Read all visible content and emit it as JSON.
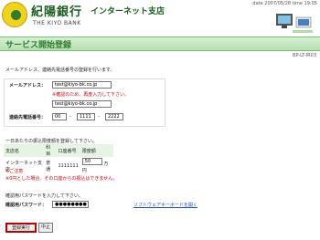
{
  "header": {
    "bank_name": "紀陽銀行",
    "branch_name": "インターネット支店",
    "bank_name_en": "THE KIYO BANK",
    "date_text": "date 2007/05/28 time 19:05"
  },
  "page": {
    "title": "サービス開始登録",
    "screen_code": "BP-LT-IR03",
    "instruction": "メールアドレス、連絡先電話番号の登録を行います。"
  },
  "contact_form": {
    "email_label": "メールアドレス：",
    "email_value": "test@kiyo-bk.co.jp",
    "email_note": "※確認のため、再度入力して下さい。",
    "email_confirm_value": "test@kiyo-bk.co.jp",
    "phone_label": "連絡先電話番号：",
    "phone_part1": "00",
    "phone_part2": "1111",
    "phone_part3": "2222",
    "phone_sep1": "-",
    "phone_sep2": "-"
  },
  "transfer_limit": {
    "instruction": "一日あたりの振込限度額を登録して下さい。",
    "headers": [
      "支店名",
      "科目",
      "口座番号",
      "限度額"
    ],
    "row": {
      "branch": "インターネット支店",
      "type": "普通",
      "account": "1111111",
      "limit": "50",
      "unit": "万円"
    },
    "note_title": "※ご注意",
    "note_text": "※0円とした場合、その口座からの振込はできません。"
  },
  "password": {
    "instruction": "確認用パスワードを入力して下さい。",
    "label": "確認用パスワード：",
    "value": "●●●●●●●●",
    "software_keyboard_link": "ソフトウェアキーボードを開く"
  },
  "buttons": {
    "submit": "登録実行",
    "cancel": "中止"
  }
}
